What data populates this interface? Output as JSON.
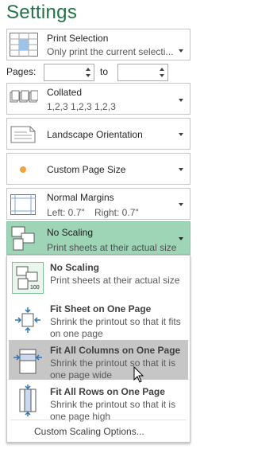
{
  "header": {
    "title": "Settings"
  },
  "print_what": {
    "title": "Print Selection",
    "subtitle": "Only print the current selecti..."
  },
  "pages": {
    "label": "Pages:",
    "to_label": "to",
    "from_value": "",
    "to_value": ""
  },
  "collation": {
    "title": "Collated",
    "subtitle": "1,2,3    1,2,3    1,2,3"
  },
  "orientation": {
    "title": "Landscape Orientation"
  },
  "paper_size": {
    "title": "Custom Page Size"
  },
  "margins": {
    "title": "Normal Margins",
    "left": "Left:  0.7\"",
    "right": "Right:  0.7\""
  },
  "scaling": {
    "selected_title": "No Scaling",
    "selected_subtitle": "Print sheets at their actual size",
    "options": [
      {
        "title": "No Scaling",
        "desc": "Print sheets at their actual size"
      },
      {
        "title": "Fit Sheet on One Page",
        "desc": "Shrink the printout so that it fits on one page"
      },
      {
        "title": "Fit All Columns on One Page",
        "desc": "Shrink the printout so that it is one page wide"
      },
      {
        "title": "Fit All Rows on One Page",
        "desc": "Shrink the printout so that it is one page high"
      }
    ],
    "custom_label": "Custom Scaling Options..."
  },
  "colors": {
    "accent": "#217346",
    "selected_bg": "#9fd5b7",
    "hover_bg": "#c6c6c6"
  }
}
